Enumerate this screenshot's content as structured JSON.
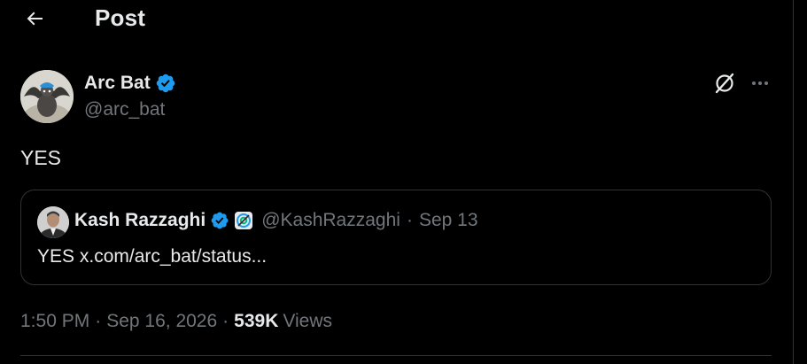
{
  "header": {
    "back_icon": "arrow-left-icon",
    "title": "Post"
  },
  "post": {
    "author": {
      "name": "Arc Bat",
      "handle": "@arc_bat",
      "verified_icon": "verified-badge-icon"
    },
    "actions": {
      "grok_icon": "grok-icon",
      "more_icon": "more-horizontal-icon"
    },
    "text": "YES",
    "quote": {
      "author_name": "Kash Razzaghi",
      "verified_icon": "verified-badge-icon",
      "affiliate_icon": "affiliate-badge-icon",
      "handle": "@KashRazzaghi",
      "separator": "·",
      "date": "Sep 13",
      "text": "YES x.com/arc_bat/status..."
    },
    "meta": {
      "time": "1:50 PM",
      "separator": "·",
      "date": "Sep 16, 2026",
      "views_count": "539K",
      "views_label": "Views"
    }
  },
  "colors": {
    "background": "#000000",
    "primary_text": "#e7e9ea",
    "secondary_text": "#71767b",
    "verified_blue": "#1d9bf0",
    "border": "#2f3336"
  }
}
